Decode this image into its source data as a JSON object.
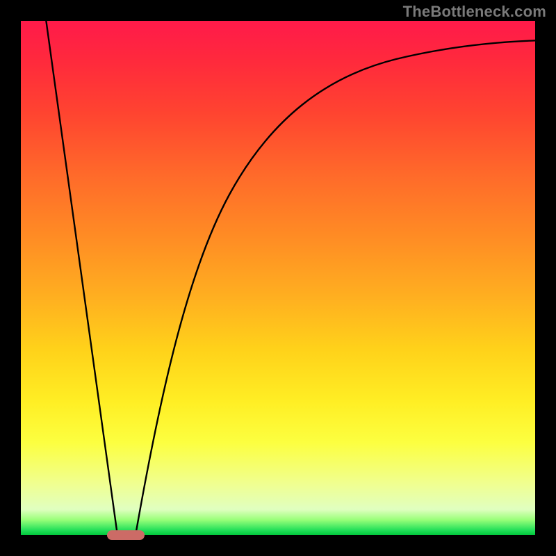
{
  "watermark": "TheBottleneck.com",
  "chart_data": {
    "type": "line",
    "title": "",
    "xlabel": "",
    "ylabel": "",
    "xlim": [
      0,
      100
    ],
    "ylim": [
      0,
      100
    ],
    "series": [
      {
        "name": "left-line",
        "x": [
          4.7,
          18.8
        ],
        "values": [
          100,
          0
        ]
      },
      {
        "name": "right-curve",
        "x": [
          22.3,
          27,
          32.4,
          40.5,
          48.6,
          59.5,
          73,
          86.5,
          101.4
        ],
        "values": [
          0,
          27,
          51.4,
          66.2,
          78,
          85,
          89.5,
          92.5,
          96.2
        ]
      }
    ],
    "marker": {
      "x_center": 20.5,
      "y": 0,
      "color": "#cc6b66",
      "shape": "rounded-rect"
    },
    "background_gradient": {
      "type": "vertical",
      "stops": [
        {
          "pos": 0.0,
          "color": "#ff1a4a"
        },
        {
          "pos": 0.3,
          "color": "#ff6a2a"
        },
        {
          "pos": 0.64,
          "color": "#ffd21a"
        },
        {
          "pos": 0.82,
          "color": "#fcff40"
        },
        {
          "pos": 0.95,
          "color": "#e0ffc0"
        },
        {
          "pos": 1.0,
          "color": "#00c83c"
        }
      ]
    },
    "legend": null,
    "grid": false
  }
}
